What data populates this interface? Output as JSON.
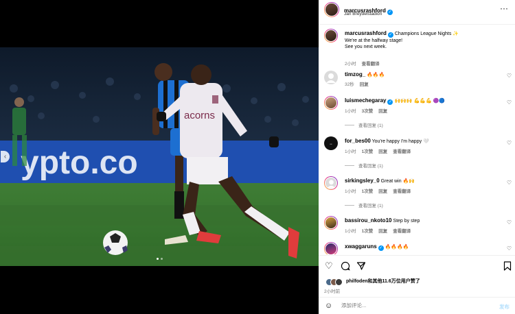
{
  "header": {
    "username": "marcusrashford",
    "location": "Jan Breydelstadion"
  },
  "caption": {
    "username": "marcusrashford",
    "title": "Champions League Nights ✨",
    "line2": "We're at the halfway stage!",
    "line3": "See you next week.",
    "time": "2小时",
    "translate": "查看翻译"
  },
  "comments": [
    {
      "username": "timzog_",
      "text": "🔥🔥🔥",
      "time": "32秒",
      "likes": "",
      "reply": "回复",
      "translate": "",
      "replies": ""
    },
    {
      "username": "luismechegaray",
      "verified": true,
      "text": "🙌🙌🙌 💪💪💪 🟣🔵",
      "time": "1小时",
      "likes": "3次赞",
      "reply": "回复",
      "translate": "",
      "replies": "查看回复 (1)"
    },
    {
      "username": "for_bes00",
      "text": "You're happy I'm happy 🤍",
      "time": "1小时",
      "likes": "1次赞",
      "reply": "回复",
      "translate": "查看翻译",
      "replies": "查看回复 (1)"
    },
    {
      "username": "sirkingsley_0",
      "text": "Great win 🔥🙌",
      "time": "1小时",
      "likes": "1次赞",
      "reply": "回复",
      "translate": "查看翻译",
      "replies": "查看回复 (1)"
    },
    {
      "username": "bassirou_nkoto10",
      "text": "Step by step",
      "time": "1小时",
      "likes": "1次赞",
      "reply": "回复",
      "translate": "查看翻译",
      "replies": ""
    },
    {
      "username": "xwaggaruns",
      "verified": true,
      "text": "🔥🔥🔥🔥",
      "time": "",
      "likes": "",
      "reply": "",
      "translate": "",
      "replies": ""
    }
  ],
  "actions": {
    "likes_text": "philfoden和其他11.6万位用户赞了",
    "date": "2小时前",
    "comment_placeholder": "添加评论...",
    "post_label": "发布"
  },
  "icons": {
    "more": "more-icon",
    "heart": "heart-icon",
    "comment": "comment-icon",
    "share": "share-icon",
    "save": "bookmark-icon",
    "emoji": "emoji-icon"
  },
  "colors": {
    "verified": "#0095f6",
    "muted": "#737373",
    "post_disabled": "#b3dffc"
  },
  "photo": {
    "ad_board_text": "ypto.co",
    "shirt_sponsor": "acorns",
    "carousel_index": 1,
    "carousel_total": 2
  }
}
